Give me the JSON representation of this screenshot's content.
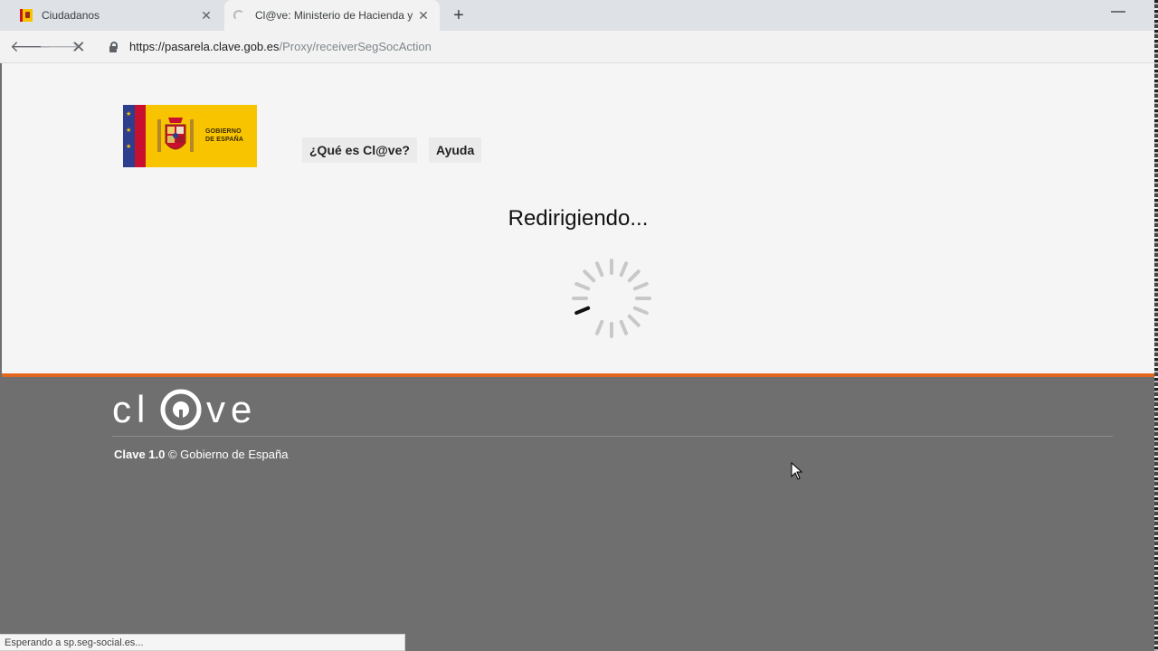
{
  "browser": {
    "tabs": [
      {
        "title": "Ciudadanos",
        "active": false
      },
      {
        "title": "Cl@ve: Ministerio de Hacienda y",
        "active": true
      }
    ],
    "new_tab": "+",
    "url_host": "https://pasarela.clave.gob.es",
    "url_path": "/Proxy/receiverSegSocAction",
    "status_text": "Esperando a sp.seg-social.es..."
  },
  "page": {
    "logo_text_line1": "GOBIERNO",
    "logo_text_line2": "DE ESPAÑA",
    "nav": {
      "que_es": "¿Qué es Cl@ve?",
      "ayuda": "Ayuda"
    },
    "redirecting": "Redirigiendo..."
  },
  "footer": {
    "brand": "cl@ve",
    "copyright_bold": "Clave 1.0",
    "copyright_rest": " © Gobierno de España"
  },
  "colors": {
    "accent_orange": "#e3661f",
    "footer_gray": "#6f6f6f",
    "logo_yellow": "#f8c400"
  }
}
